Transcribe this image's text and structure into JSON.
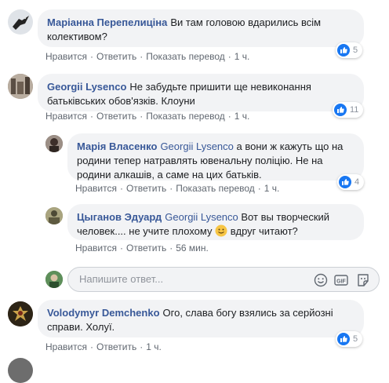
{
  "actions": {
    "like": "Нравится",
    "reply": "Ответить",
    "translate": "Показать перевод"
  },
  "comments": [
    {
      "author": "Маріанна Перепелиціна",
      "text": "Ви там головою вдарились всім колективом?",
      "time": "1 ч.",
      "likes": "5"
    },
    {
      "author": "Georgii Lysenco",
      "text": "Не забудьте пришити ще невиконання батьківських обов'язків. Клоуни",
      "time": "1 ч.",
      "likes": "11",
      "replies": [
        {
          "author": "Марія Власенко",
          "tag": "Georgii Lysenco",
          "text": "а вони ж кажуть що на родини тепер натравлять ювенальну поліцію. Не на родини алкашів, а саме на цих батьків.",
          "time": "1 ч.",
          "likes": "4"
        },
        {
          "author": "Цыганов Эдуард",
          "tag": "Georgii Lysenco",
          "text_before": "Вот вы творческий человек.... не учите плохому",
          "text_after": "вдруг читают?",
          "time": "56 мин."
        }
      ]
    },
    {
      "author": "Volodymyr Demchenko",
      "text": "Ого, слава богу взялись за серйозні справи. Холуї.",
      "time": "1 ч.",
      "likes": "5"
    }
  ],
  "reply_input": {
    "placeholder": "Напишите ответ..."
  },
  "icons": {
    "like": "thumbs-up-icon",
    "emoji": "smiley-icon",
    "gif": "gif-icon",
    "sticker": "sticker-icon"
  },
  "colors": {
    "author": "#385898",
    "like_blue": "#1877f2",
    "bubble": "#f2f3f5"
  }
}
